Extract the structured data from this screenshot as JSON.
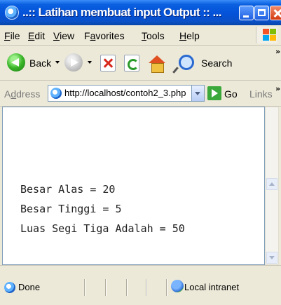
{
  "window": {
    "title": "..:: Latihan membuat input Output :: ... "
  },
  "menu": {
    "items": [
      {
        "ul": "F",
        "rest": "ile"
      },
      {
        "ul": "E",
        "rest": "dit"
      },
      {
        "ul": "V",
        "rest": "iew"
      },
      {
        "pre": "F",
        "ul": "a",
        "rest": "vorites"
      },
      {
        "ul": "T",
        "rest": "ools"
      },
      {
        "ul": "H",
        "rest": "elp"
      }
    ]
  },
  "toolbar": {
    "back_label": "Back",
    "search_label": "Search",
    "overflow": "»"
  },
  "address": {
    "label_ul": "d",
    "label_pre": "A",
    "label_rest": "dress",
    "url": "http://localhost/contoh2_3.php",
    "go_label": "Go",
    "links_label": "Links",
    "overflow": "»"
  },
  "content": {
    "lines": [
      "Besar Alas = 20",
      "Besar Tinggi = 5",
      "Luas Segi Tiga Adalah = 50"
    ]
  },
  "status": {
    "text": "Done",
    "zone": "Local intranet"
  },
  "colors": {
    "titlebar": "#0a50c8",
    "chrome": "#ece9d8",
    "close": "#d43a10"
  }
}
